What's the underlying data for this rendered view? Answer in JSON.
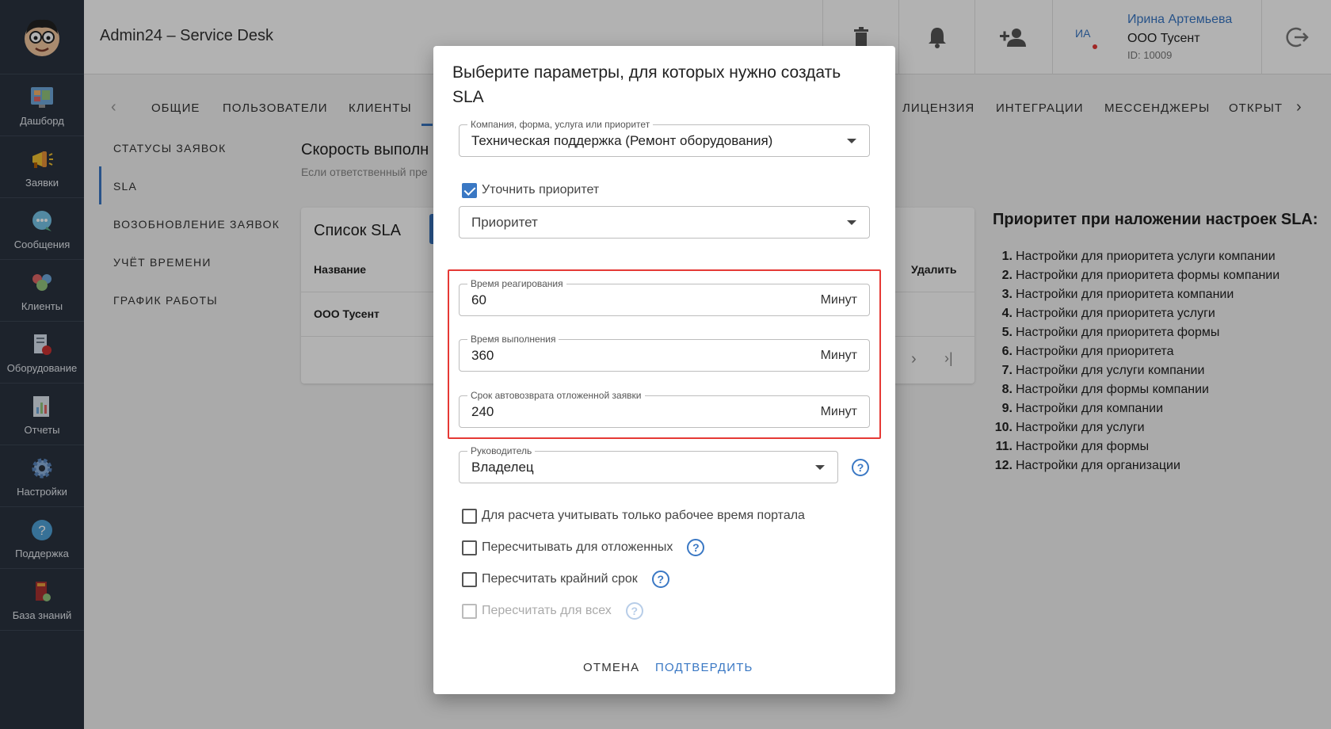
{
  "sidebar": {
    "items": [
      {
        "label": "Дашборд",
        "icon": "dashboard-icon"
      },
      {
        "label": "Заявки",
        "icon": "megaphone-icon"
      },
      {
        "label": "Сообщения",
        "icon": "chat-icon"
      },
      {
        "label": "Клиенты",
        "icon": "clients-icon"
      },
      {
        "label": "Оборудование",
        "icon": "equipment-icon"
      },
      {
        "label": "Отчеты",
        "icon": "reports-icon"
      },
      {
        "label": "Настройки",
        "icon": "gear-icon"
      },
      {
        "label": "Поддержка",
        "icon": "help-icon"
      },
      {
        "label": "База знаний",
        "icon": "book-icon"
      }
    ]
  },
  "header": {
    "title": "Admin24 – Service Desk",
    "user": {
      "initials": "ИА",
      "name": "Ирина Артемьева",
      "org": "ООО Тусент",
      "id": "ID: 10009"
    }
  },
  "tabs": {
    "items": [
      "ОБЩИЕ",
      "ПОЛЬЗОВАТЕЛИ",
      "КЛИЕНТЫ",
      "ЛИЦЕНЗИЯ",
      "ИНТЕГРАЦИИ",
      "МЕССЕНДЖЕРЫ",
      "ОТКРЫТ"
    ]
  },
  "subnav": {
    "items": [
      "СТАТУСЫ ЗАЯВОК",
      "SLA",
      "ВОЗОБНОВЛЕНИЕ ЗАЯВОК",
      "УЧЁТ ВРЕМЕНИ",
      "ГРАФИК РАБОТЫ"
    ],
    "active": "SLA"
  },
  "content": {
    "title": "Скорость выполн",
    "subtitle": "Если ответственный пре",
    "card": {
      "title": "Список SLA",
      "col_name": "Название",
      "col_delete": "Удалить",
      "row_name": "ООО Тусент"
    },
    "priority": {
      "title": "Приоритет при наложении настроек SLA:",
      "items": [
        {
          "n": "1.",
          "text": "Настройки для приоритета услуги компании"
        },
        {
          "n": "2.",
          "text": "Настройки для приоритета формы компании"
        },
        {
          "n": "3.",
          "text": "Настройки для приоритета компании"
        },
        {
          "n": "4.",
          "text": "Настройки для приоритета услуги"
        },
        {
          "n": "5.",
          "text": "Настройки для приоритета формы"
        },
        {
          "n": "6.",
          "text": "Настройки для приоритета"
        },
        {
          "n": "7.",
          "text": "Настройки для услуги компании"
        },
        {
          "n": "8.",
          "text": "Настройки для формы компании"
        },
        {
          "n": "9.",
          "text": "Настройки для компании"
        },
        {
          "n": "10.",
          "text": "Настройки для услуги"
        },
        {
          "n": "11.",
          "text": "Настройки для формы"
        },
        {
          "n": "12.",
          "text": "Настройки для организации"
        }
      ]
    }
  },
  "dialog": {
    "title": "Выберите параметры, для которых нужно создать SLA",
    "scope": {
      "legend": "Компания, форма, услуга или приоритет",
      "value": "Техническая поддержка (Ремонт оборудования)"
    },
    "refine_priority": {
      "label": "Уточнить приоритет",
      "checked": true
    },
    "priority": {
      "placeholder": "Приоритет"
    },
    "reaction_time": {
      "legend": "Время реагирования",
      "value": "60",
      "unit": "Минут"
    },
    "completion_time": {
      "legend": "Время выполнения",
      "value": "360",
      "unit": "Минут"
    },
    "auto_return": {
      "legend": "Срок автовозврата отложенной заявки",
      "value": "240",
      "unit": "Минут"
    },
    "manager": {
      "legend": "Руководитель",
      "value": "Владелец"
    },
    "options": [
      {
        "label": "Для расчета учитывать только рабочее время портала",
        "checked": false,
        "disabled": false,
        "help": false
      },
      {
        "label": "Пересчитывать для отложенных",
        "checked": false,
        "disabled": false,
        "help": true
      },
      {
        "label": "Пересчитать крайний срок",
        "checked": false,
        "disabled": false,
        "help": true
      },
      {
        "label": "Пересчитать для всех",
        "checked": false,
        "disabled": true,
        "help": true
      }
    ],
    "help_glyph": "?",
    "cancel": "ОТМЕНА",
    "confirm": "ПОДТВЕРДИТЬ"
  },
  "colors": {
    "accent": "#3a78c4",
    "highlight": "#e53935",
    "sidebar": "#2a3340"
  }
}
